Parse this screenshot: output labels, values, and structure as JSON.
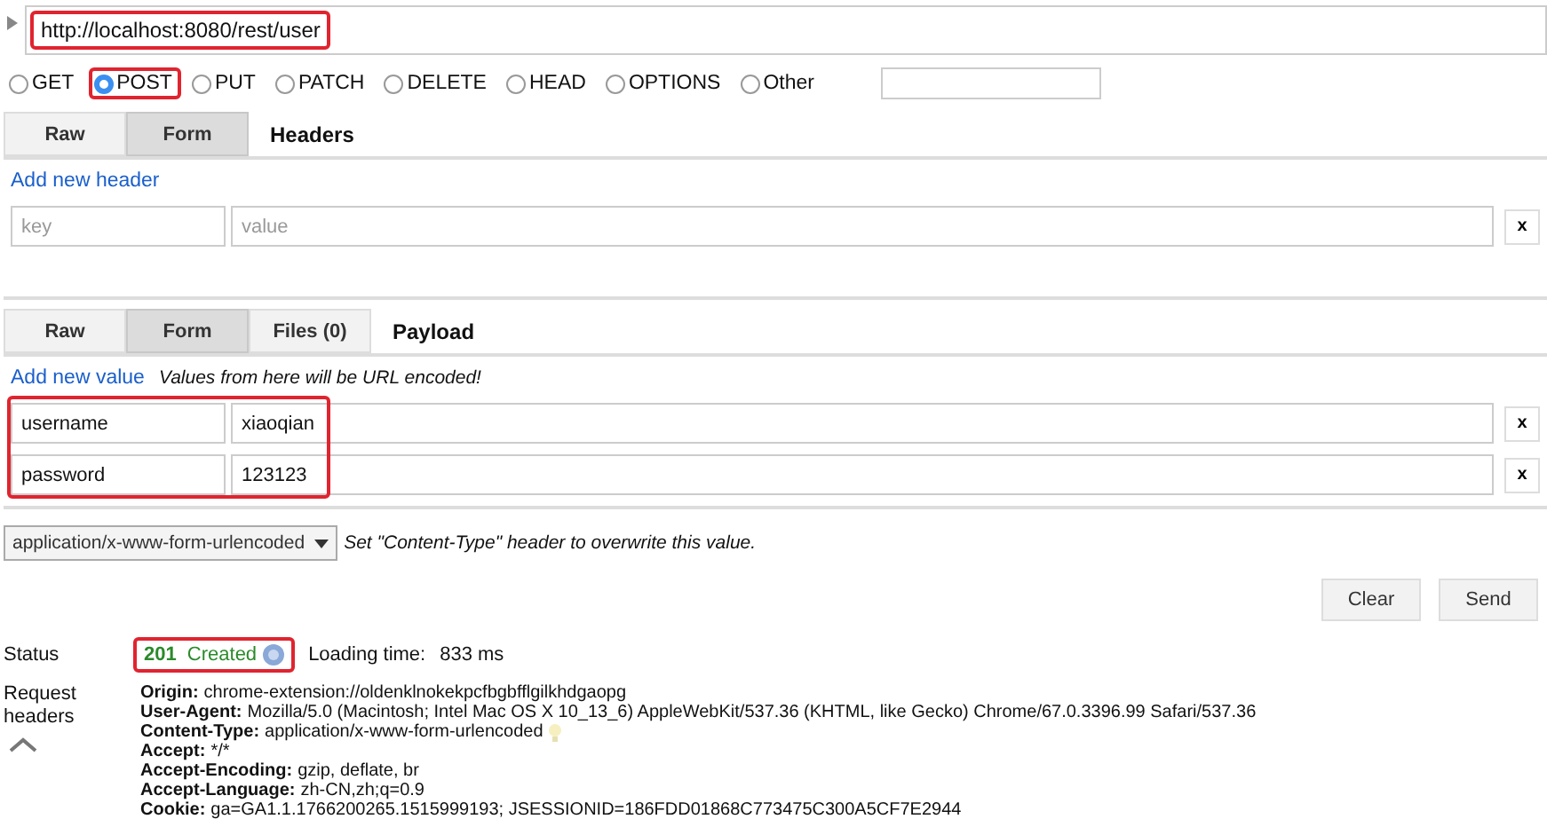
{
  "url": {
    "value": "http://localhost:8080/rest/user",
    "highlighted": true
  },
  "methods": [
    {
      "label": "GET",
      "selected": false
    },
    {
      "label": "POST",
      "selected": true
    },
    {
      "label": "PUT",
      "selected": false
    },
    {
      "label": "PATCH",
      "selected": false
    },
    {
      "label": "DELETE",
      "selected": false
    },
    {
      "label": "HEAD",
      "selected": false
    },
    {
      "label": "OPTIONS",
      "selected": false
    },
    {
      "label": "Other",
      "selected": false
    }
  ],
  "headers_section": {
    "tabs": [
      {
        "label": "Raw",
        "selected": false
      },
      {
        "label": "Form",
        "selected": true
      }
    ],
    "title": "Headers",
    "add_link": "Add new header",
    "rows": [
      {
        "key_placeholder": "key",
        "value_placeholder": "value",
        "remove": "x"
      }
    ]
  },
  "payload_section": {
    "tabs": [
      {
        "label": "Raw",
        "selected": false
      },
      {
        "label": "Form",
        "selected": true
      },
      {
        "label": "Files (0)",
        "selected": false
      }
    ],
    "title": "Payload",
    "add_link": "Add new value",
    "note": "Values from here will be URL encoded!",
    "highlighted": true,
    "rows": [
      {
        "key": "username",
        "value": "xiaoqian",
        "remove": "x"
      },
      {
        "key": "password",
        "value": "123123",
        "remove": "x"
      }
    ]
  },
  "content_type": {
    "value": "application/x-www-form-urlencoded",
    "hint": "Set \"Content-Type\" header to overwrite this value."
  },
  "buttons": [
    "Clear",
    "Send"
  ],
  "status": {
    "label": "Status",
    "code": "201",
    "text": "Created",
    "highlighted": true,
    "loading_label": "Loading time:",
    "loading_value": "833 ms"
  },
  "request_headers": {
    "label": "Request headers",
    "items": [
      {
        "name": "Origin:",
        "value": "chrome-extension://oldenklnokekpcfbgbfflgilkhdgaopg",
        "hint": false
      },
      {
        "name": "User-Agent:",
        "value": "Mozilla/5.0 (Macintosh; Intel Mac OS X 10_13_6) AppleWebKit/537.36 (KHTML, like Gecko) Chrome/67.0.3396.99 Safari/537.36",
        "hint": false
      },
      {
        "name": "Content-Type:",
        "value": "application/x-www-form-urlencoded",
        "hint": true
      },
      {
        "name": "Accept:",
        "value": "*/*",
        "hint": false
      },
      {
        "name": "Accept-Encoding:",
        "value": "gzip, deflate, br",
        "hint": false
      },
      {
        "name": "Accept-Language:",
        "value": "zh-CN,zh;q=0.9",
        "hint": false
      },
      {
        "name": "Cookie:",
        "value": "  ga=GA1.1.1766200265.1515999193; JSESSIONID=186FDD01868C773475C300A5CF7E2944",
        "hint": false
      }
    ]
  }
}
